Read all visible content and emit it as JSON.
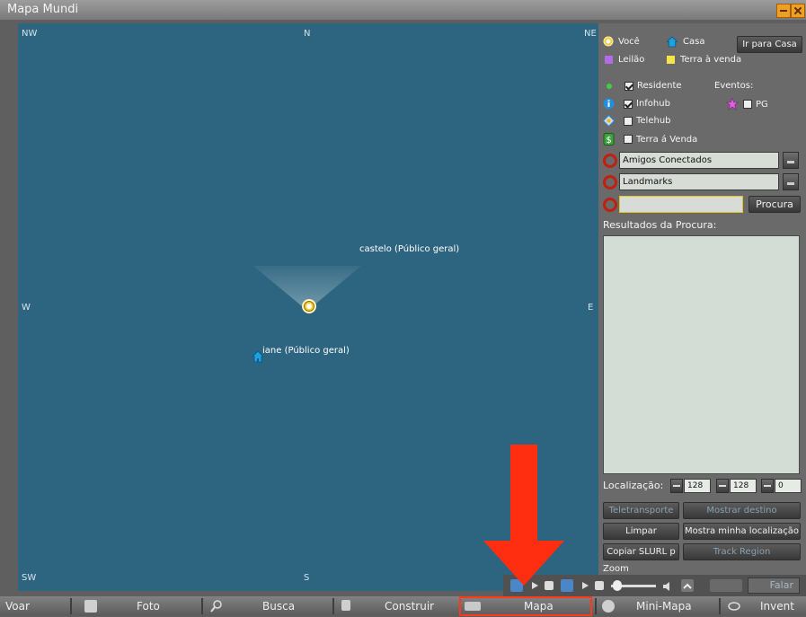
{
  "window": {
    "title": "Mapa Mundi"
  },
  "map": {
    "compass": {
      "nw": "NW",
      "n": "N",
      "ne": "NE",
      "w": "W",
      "e": "E",
      "sw": "SW",
      "s": "S"
    },
    "labels": {
      "castle": "castelo (Público geral)",
      "home": "iane (Público geral)"
    }
  },
  "legend": {
    "you": "Você",
    "home": "Casa",
    "go_home": "Ir para Casa",
    "auction": "Leilão",
    "land_for_sale": "Terra à venda",
    "resident": "Residente",
    "events": "Eventos:",
    "infohub": "Infohub",
    "pg": "PG",
    "telehub": "Telehub",
    "land_sale": "Terra á Venda",
    "colors": {
      "you": "#f5cc3a",
      "auction": "#b36be8",
      "land_for_sale": "#f5e44a",
      "resident": "#3fd040"
    }
  },
  "combos": {
    "friends": "Amigos Conectados",
    "landmarks": "Landmarks"
  },
  "search": {
    "value": "",
    "button": "Procura",
    "results_label": "Resultados da Procura:"
  },
  "location": {
    "label": "Localização:",
    "x": "128",
    "y": "128",
    "z": "0"
  },
  "buttons": {
    "teleport": "Teletransporte",
    "show_dest": "Mostrar destino",
    "clear": "Limpar",
    "show_my_loc": "Mostra minha localização",
    "copy_slurl": "Copiar SLURL p",
    "track_region": "Track Region"
  },
  "zoom_label": "Zoom",
  "media": {
    "speak": "Falar"
  },
  "toolbar": {
    "fly": "Voar",
    "photo": "Foto",
    "search": "Busca",
    "build": "Construir",
    "map": "Mapa",
    "minimap": "Mini-Mapa",
    "inventory": "Invent"
  },
  "colors": {
    "accent": "#ff2e10",
    "map_bg": "#2d6580"
  }
}
